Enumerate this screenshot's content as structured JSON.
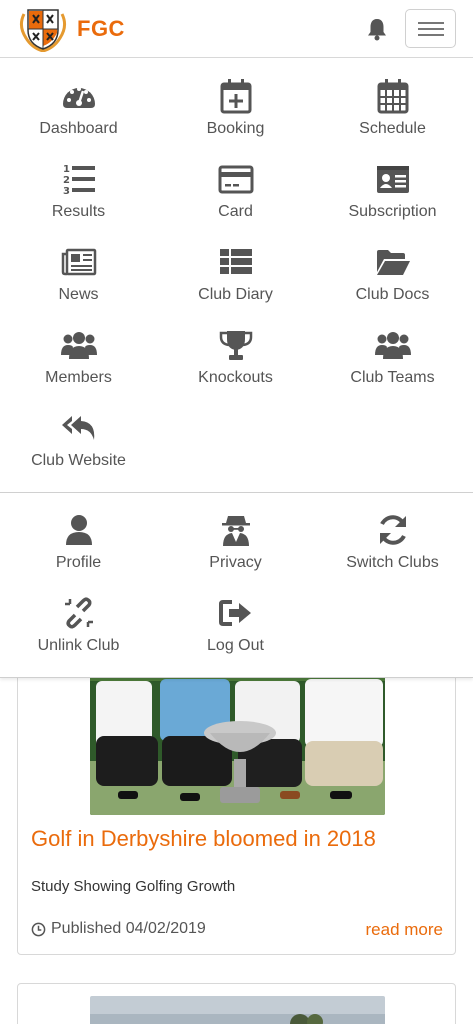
{
  "header": {
    "brand": "FGC",
    "notification_icon": "bell-icon",
    "menu_icon": "hamburger-icon"
  },
  "menu": {
    "primary": [
      {
        "label": "Dashboard",
        "icon": "tachometer-icon"
      },
      {
        "label": "Booking",
        "icon": "calendar-plus-icon"
      },
      {
        "label": "Schedule",
        "icon": "calendar-grid-icon"
      },
      {
        "label": "Results",
        "icon": "ordered-list-icon"
      },
      {
        "label": "Card",
        "icon": "credit-card-icon"
      },
      {
        "label": "Subscription",
        "icon": "id-card-icon"
      },
      {
        "label": "News",
        "icon": "newspaper-icon"
      },
      {
        "label": "Club Diary",
        "icon": "table-list-icon"
      },
      {
        "label": "Club Docs",
        "icon": "folder-open-icon"
      },
      {
        "label": "Members",
        "icon": "users-icon"
      },
      {
        "label": "Knockouts",
        "icon": "trophy-icon"
      },
      {
        "label": "Club Teams",
        "icon": "users-icon"
      },
      {
        "label": "Club Website",
        "icon": "reply-all-icon"
      }
    ],
    "secondary": [
      {
        "label": "Profile",
        "icon": "user-icon"
      },
      {
        "label": "Privacy",
        "icon": "user-secret-icon"
      },
      {
        "label": "Switch Clubs",
        "icon": "refresh-icon"
      },
      {
        "label": "Unlink Club",
        "icon": "unlink-icon"
      },
      {
        "label": "Log Out",
        "icon": "sign-out-icon"
      }
    ]
  },
  "news": [
    {
      "title": "Golf in Derbyshire bloomed in 2018",
      "subtitle": "Study Showing Golfing Growth",
      "published": "Published 04/02/2019",
      "read_more": "read more"
    }
  ],
  "colors": {
    "accent": "#ea6b0c",
    "icon": "#555555",
    "border": "#d8d8d8"
  }
}
